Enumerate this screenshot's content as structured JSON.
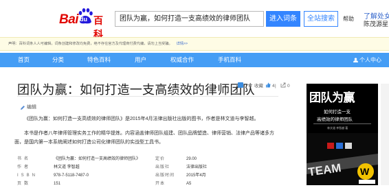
{
  "header": {
    "logo_text_bai": "Bai",
    "logo_text_du": "du",
    "logo_text_baike": "百科",
    "search_value": "团队为赢，如何打造一支高绩效的律师团队",
    "enter_label": "进入词条",
    "fullsearch_label": "全站搜索",
    "help_label": "帮助",
    "promo_title": "了解处女",
    "promo_sub": "陈茂源星"
  },
  "notice": {
    "text": "声明：百科词条人人可编辑，词条创建和修改均免费，绝不存在官方及代理商付费代编，请勿上当受骗。",
    "link": "详情>>"
  },
  "nav": {
    "items": [
      "首页",
      "分类",
      "特色百科",
      "用户",
      "权威合作",
      "手机百科"
    ],
    "user_label": "个人中心"
  },
  "article": {
    "title": "团队为赢：如何打造一支高绩效的律师团队",
    "edit_label": "编辑",
    "collect_label": "收藏",
    "like_count": "4",
    "share_count": "0",
    "para1": "《团队为赢：如何打造一支高绩效的律师团队》是2015年4月法律出版社出版的图书，作者是林文道与李智越。",
    "para2": "本书是作者八年律师管理实务工作的精华提炼。内容涵盖律师团队组建、团队品牌塑造、律师营销、法律产品等诸多方面，是国内第一本系统阐述如何打造公司化律师团队的实战型工具书。"
  },
  "info": [
    {
      "k1": "书名",
      "v1": "《团队为赢：如何打造一支高绩效的律师团队》",
      "k2": "定价",
      "v2": "29.00"
    },
    {
      "k1": "作者",
      "v1": "林文道 李智越",
      "k2": "出版社",
      "v2": "法律出版社"
    },
    {
      "k1": "ISBN",
      "v1": "978-7-5118-7487-0",
      "k2": "出版时间",
      "v2": "2015年4月"
    },
    {
      "k1": "页数",
      "v1": "151",
      "k2": "开本",
      "v2": "A5"
    }
  ],
  "cover": {
    "title": "团队为赢",
    "sub1": "如何打造一支",
    "sub2": "高绩效的律师团队",
    "small": "林文道 李智越 著"
  },
  "colors": {
    "brand_red": "#e10601",
    "brand_blue": "#3385ff",
    "nav_blue": "#459df5",
    "notice_bg": "#fefce5"
  }
}
